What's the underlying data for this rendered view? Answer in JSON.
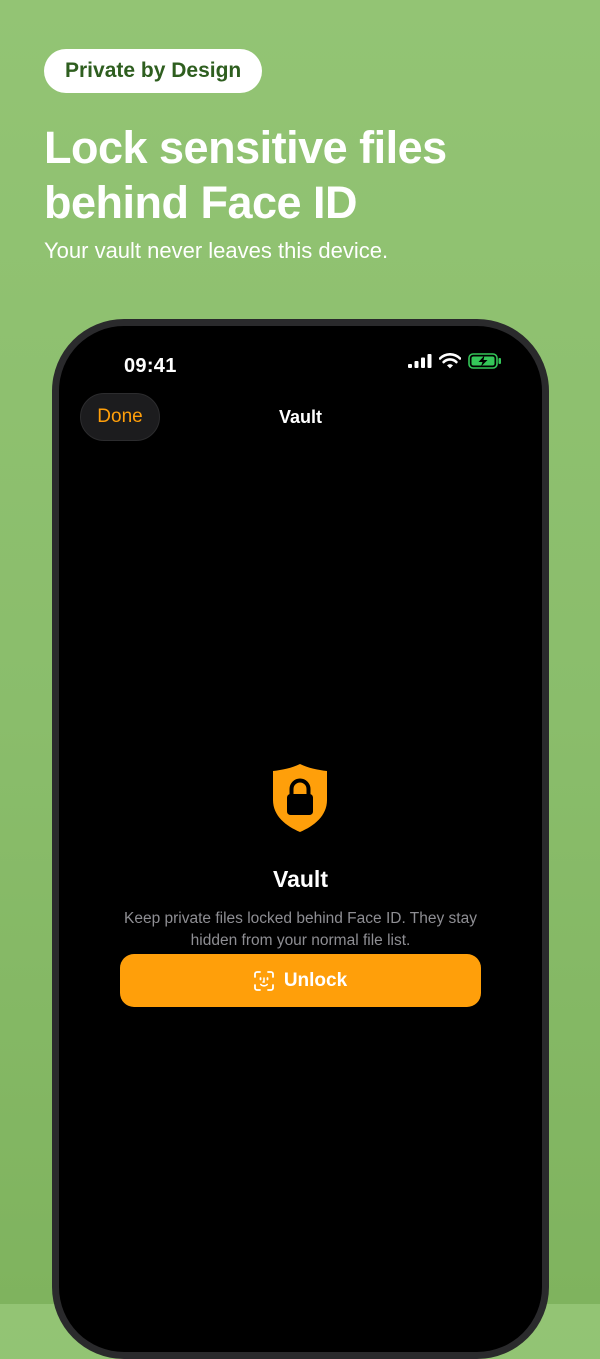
{
  "promo": {
    "badge": "Private by Design",
    "headline": "Lock sensitive files behind Face ID",
    "subline": "Your vault never leaves this device."
  },
  "status_bar": {
    "time": "09:41",
    "icons": [
      "cellular-signal-icon",
      "wifi-icon",
      "battery-charging-icon"
    ]
  },
  "nav": {
    "done_label": "Done",
    "title": "Vault"
  },
  "vault": {
    "icon": "shield-lock-icon",
    "title": "Vault",
    "description": "Keep private files locked behind Face ID. They stay hidden from your normal file list.",
    "unlock_label": "Unlock",
    "unlock_icon": "face-id-icon"
  },
  "colors": {
    "background": "#8dbf6c",
    "accent": "#ff9f0a",
    "battery": "#34c759",
    "badge_text": "#2e5e1f"
  }
}
